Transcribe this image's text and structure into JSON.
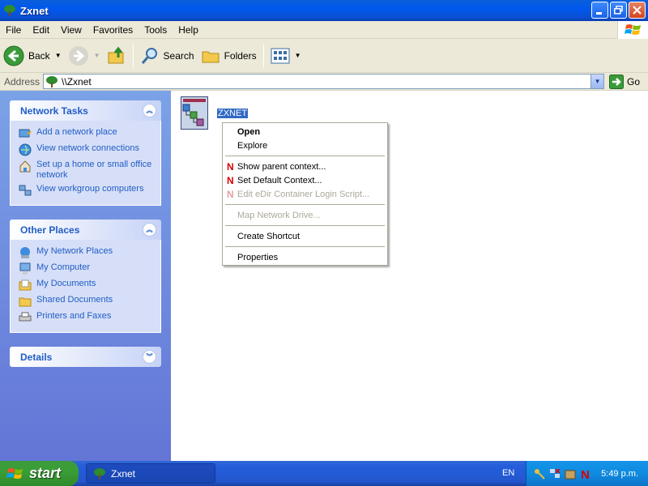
{
  "window": {
    "title": "Zxnet"
  },
  "menu": [
    "File",
    "Edit",
    "View",
    "Favorites",
    "Tools",
    "Help"
  ],
  "toolbar": {
    "back": "Back",
    "search": "Search",
    "folders": "Folders"
  },
  "address": {
    "label": "Address",
    "value": "\\\\Zxnet",
    "go": "Go"
  },
  "network_tasks": {
    "title": "Network Tasks",
    "items": [
      "Add a network place",
      "View network connections",
      "Set up a home or small office network",
      "View workgroup computers"
    ]
  },
  "other_places": {
    "title": "Other Places",
    "items": [
      "My Network Places",
      "My Computer",
      "My Documents",
      "Shared Documents",
      "Printers and Faxes"
    ]
  },
  "details": {
    "title": "Details"
  },
  "content": {
    "item_label": "ZXNET"
  },
  "context_menu": {
    "open": "Open",
    "explore": "Explore",
    "show_parent": "Show parent context...",
    "set_default": "Set Default Context...",
    "edit_edir": "Edit eDir Container Login Script...",
    "map_drive": "Map Network Drive...",
    "create_shortcut": "Create Shortcut",
    "properties": "Properties"
  },
  "taskbar": {
    "start": "start",
    "task": "Zxnet",
    "lang": "EN",
    "clock": "5:49 p.m."
  },
  "colors": {
    "link": "#215dc6",
    "selection": "#316ac5",
    "novell_red": "#d80000"
  }
}
